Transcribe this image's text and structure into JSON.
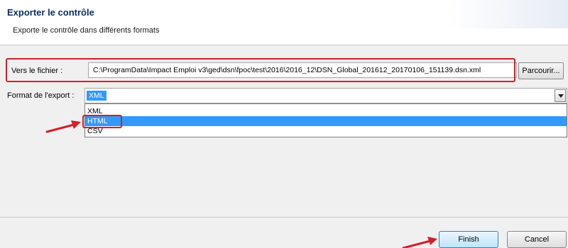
{
  "header": {
    "title": "Exporter le contrôle",
    "subtitle": "Exporte le contrôle dans différents formats"
  },
  "file": {
    "label": "Vers le fichier :",
    "path": "C:\\ProgramData\\Impact Emploi v3\\ged\\dsn\\fpoc\\test\\2016\\2016_12\\DSN_Global_201612_20170106_151139.dsn.xml",
    "browse_label": "Parcourir..."
  },
  "format": {
    "label": "Format de l'export :",
    "selected": "XML",
    "options": [
      "XML",
      "HTML",
      "CSV"
    ],
    "highlighted_option": "HTML"
  },
  "footer": {
    "finish_label": "Finish",
    "cancel_label": "Cancel"
  },
  "colors": {
    "accent": "#3399ff",
    "annotation": "#d11f2c",
    "title": "#0b2f63"
  }
}
